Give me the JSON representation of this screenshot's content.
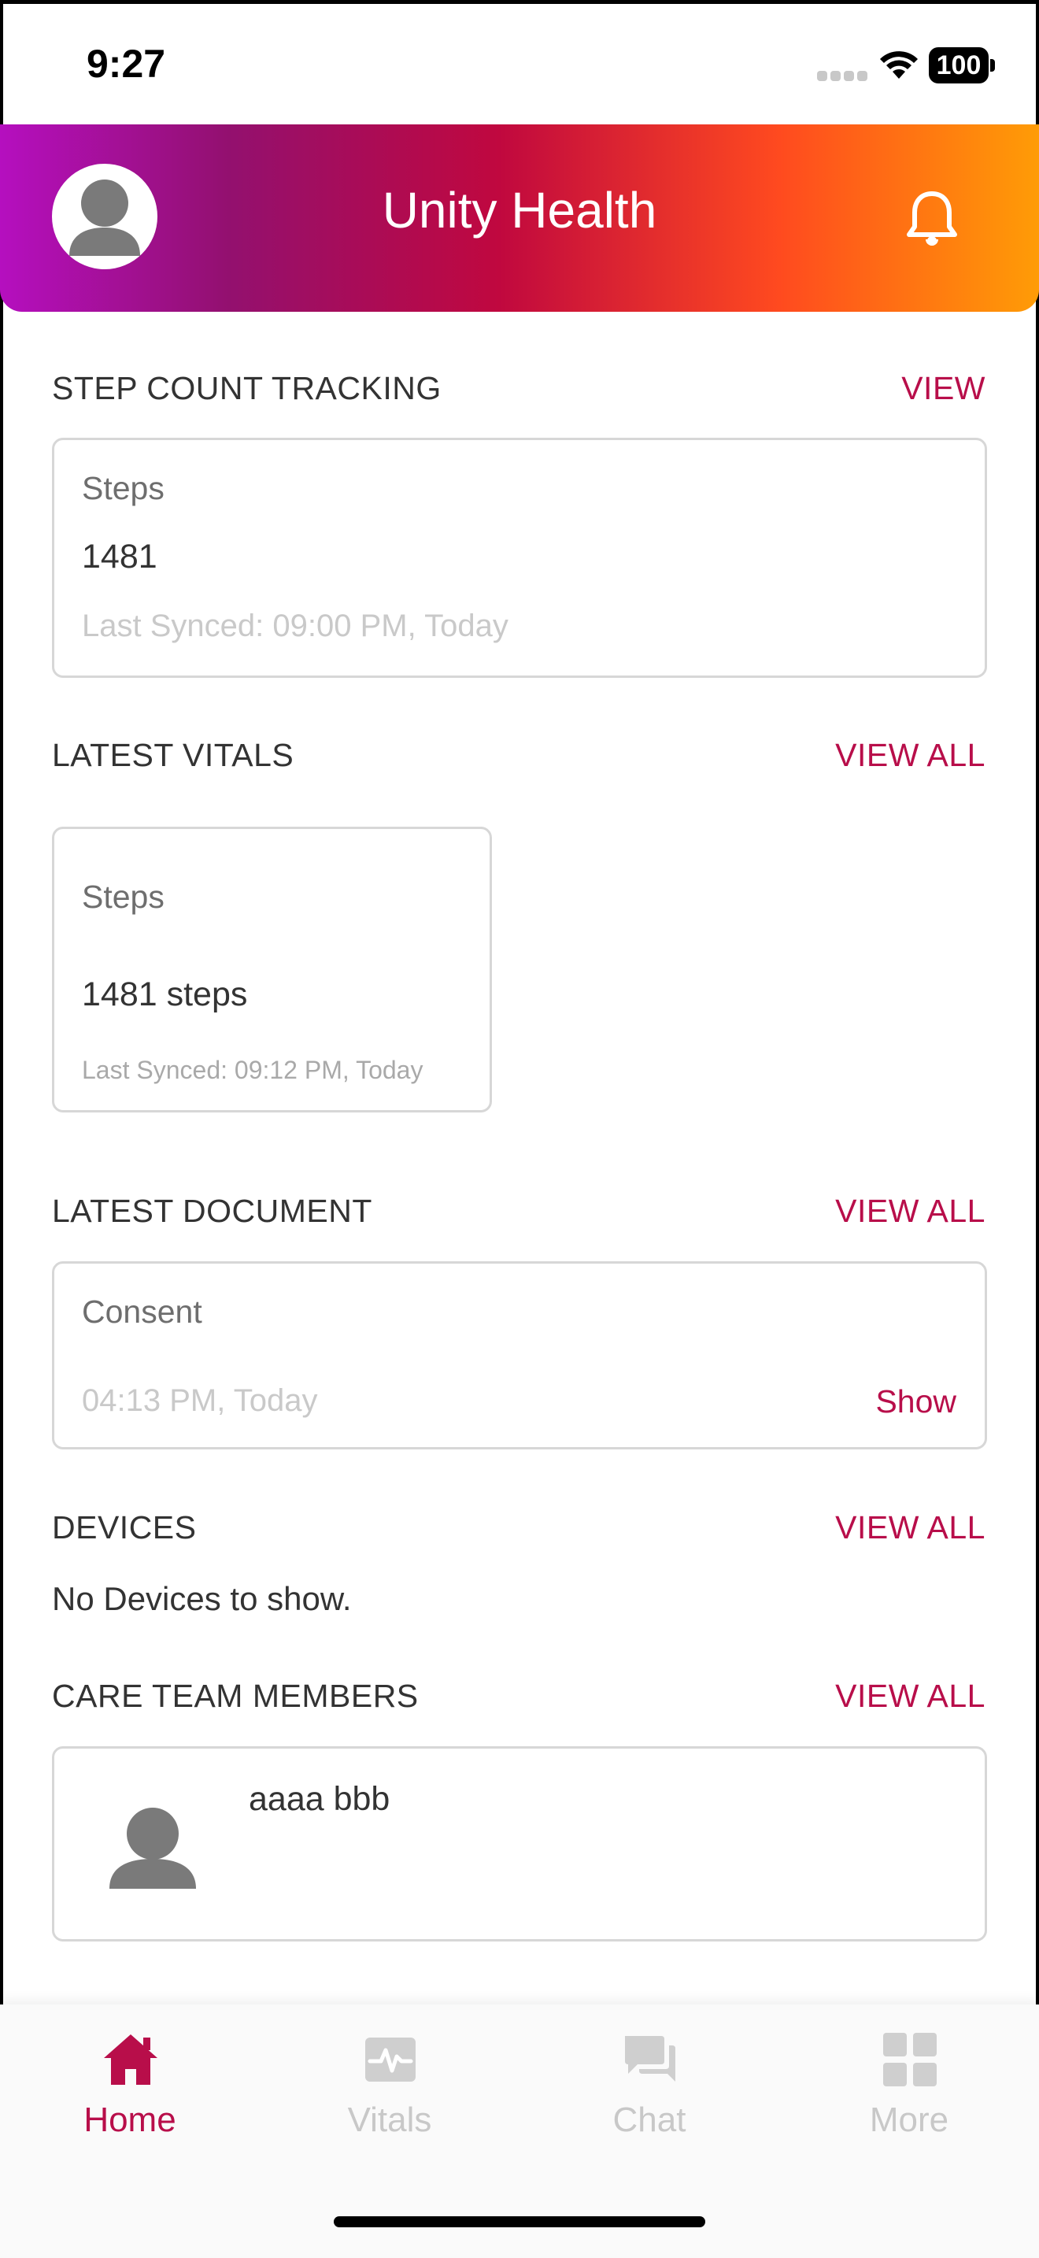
{
  "status_bar": {
    "time": "9:27",
    "battery": "100"
  },
  "header": {
    "title": "Unity Health",
    "gradient_colors": [
      "#b50fbf",
      "#93106f",
      "#c0083f",
      "#ff4a1f",
      "#ff9c06"
    ]
  },
  "accent_color": "#b80e4a",
  "step_tracking": {
    "title": "STEP COUNT TRACKING",
    "link": "VIEW",
    "label": "Steps",
    "value": "1481",
    "synced": "Last Synced: 09:00 PM, Today"
  },
  "vitals": {
    "title": "LATEST VITALS",
    "link": "VIEW ALL",
    "card": {
      "label": "Steps",
      "value": "1481 steps",
      "synced": "Last Synced: 09:12 PM, Today"
    }
  },
  "document": {
    "title": "LATEST DOCUMENT",
    "link": "VIEW ALL",
    "name": "Consent",
    "time": "04:13 PM, Today",
    "action": "Show"
  },
  "devices": {
    "title": "DEVICES",
    "link": "VIEW ALL",
    "empty_text": "No Devices to show."
  },
  "care_team": {
    "title": "CARE TEAM MEMBERS",
    "link": "VIEW ALL",
    "members": [
      {
        "name": "aaaa bbb",
        "icon": "person-icon"
      }
    ]
  },
  "tabs": [
    {
      "label": "Home",
      "icon": "home-icon",
      "active": true
    },
    {
      "label": "Vitals",
      "icon": "vitals-icon",
      "active": false
    },
    {
      "label": "Chat",
      "icon": "chat-icon",
      "active": false
    },
    {
      "label": "More",
      "icon": "grid-icon",
      "active": false
    }
  ]
}
